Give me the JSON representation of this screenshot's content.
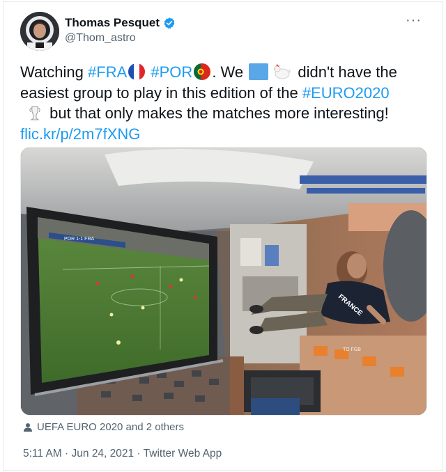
{
  "tweet": {
    "author": {
      "name": "Thomas Pesquet",
      "handle": "@Thom_astro"
    },
    "more_label": "···",
    "text": {
      "p1": "Watching ",
      "tag_fra": "#FRA",
      "p2": " ",
      "tag_por": "#POR",
      "p3": ". We ",
      "p4": " didn't have the easiest group to play in this edition of the ",
      "tag_euro": "#EURO2020",
      "p5": " but that only makes the matches more interesting!",
      "link": "flic.kr/p/2m7fXNG"
    },
    "media": {
      "screen_banner": "POR 1-1 FRA",
      "shirt_text": "FRANCE",
      "module_label": "TO FGB"
    },
    "tagged": "UEFA EURO 2020 and 2 others",
    "time": "5:11 AM",
    "separator": "·",
    "date": "Jun 24, 2021",
    "source": "Twitter Web App"
  },
  "colors": {
    "accent": "#1d9bf0",
    "secondary_text": "#536471",
    "primary_text": "#0f1419"
  },
  "icons": [
    "verified-badge-icon",
    "more-icon",
    "person-icon",
    "france-flag-icon",
    "portugal-flag-icon",
    "blue-square-icon",
    "rooster-icon",
    "trophy-icon"
  ]
}
